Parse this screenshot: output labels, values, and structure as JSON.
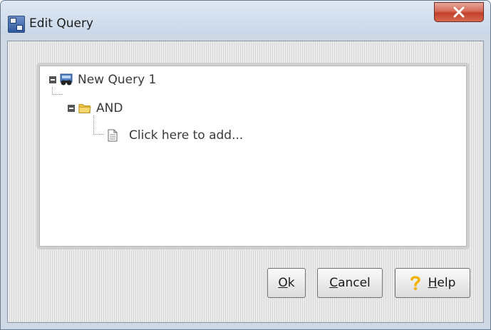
{
  "window": {
    "title": "Edit Query"
  },
  "tree": {
    "root_label": "New Query 1",
    "group_label": "AND",
    "add_label": "Click here to add..."
  },
  "buttons": {
    "ok": {
      "mnemonic": "O",
      "rest": "k"
    },
    "cancel": {
      "mnemonic": "C",
      "rest": "ancel"
    },
    "help": {
      "mnemonic": "H",
      "rest": "elp"
    }
  },
  "icons": {
    "app": "app-icon",
    "close": "close-icon",
    "root": "binoculars-icon",
    "group": "folder-icon",
    "add": "document-icon",
    "help": "question-icon"
  },
  "colors": {
    "close_button": "#c2412c",
    "folder": "#f2c744",
    "help_icon": "#f0b400"
  }
}
